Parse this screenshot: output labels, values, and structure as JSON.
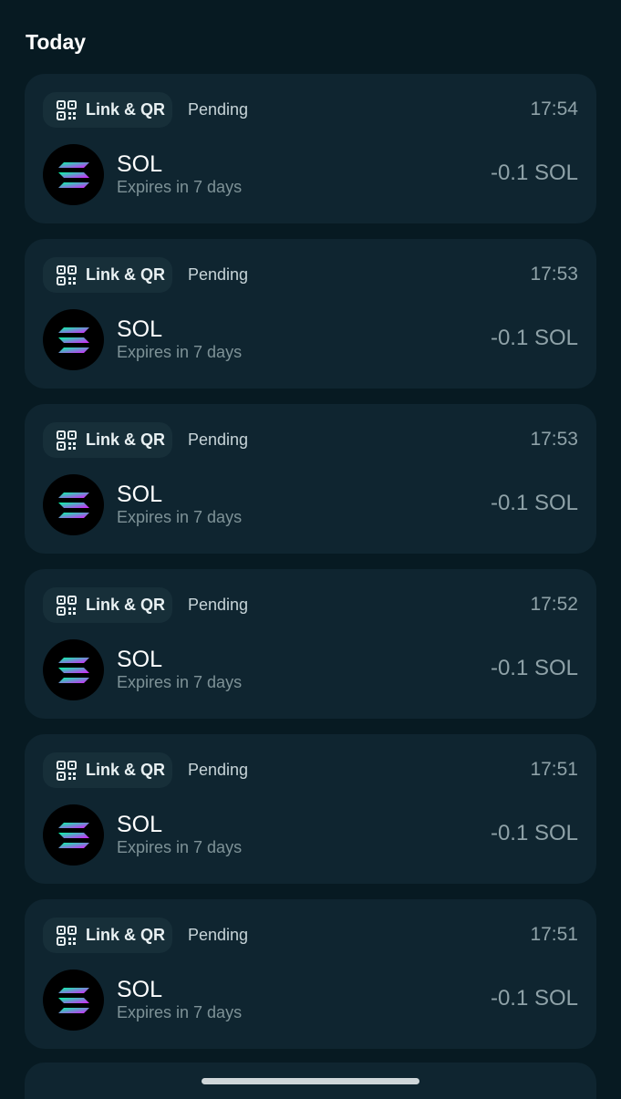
{
  "section": {
    "title": "Today"
  },
  "transactions": [
    {
      "method_icon": "qr-code-icon",
      "method": "Link & QR",
      "status": "Pending",
      "time": "17:54",
      "token_icon": "solana-logo-icon",
      "token": "SOL",
      "expiry": "Expires in 7 days",
      "amount": "-0.1 SOL"
    },
    {
      "method_icon": "qr-code-icon",
      "method": "Link & QR",
      "status": "Pending",
      "time": "17:53",
      "token_icon": "solana-logo-icon",
      "token": "SOL",
      "expiry": "Expires in 7 days",
      "amount": "-0.1 SOL"
    },
    {
      "method_icon": "qr-code-icon",
      "method": "Link & QR",
      "status": "Pending",
      "time": "17:53",
      "token_icon": "solana-logo-icon",
      "token": "SOL",
      "expiry": "Expires in 7 days",
      "amount": "-0.1 SOL"
    },
    {
      "method_icon": "qr-code-icon",
      "method": "Link & QR",
      "status": "Pending",
      "time": "17:52",
      "token_icon": "solana-logo-icon",
      "token": "SOL",
      "expiry": "Expires in 7 days",
      "amount": "-0.1 SOL"
    },
    {
      "method_icon": "qr-code-icon",
      "method": "Link & QR",
      "status": "Pending",
      "time": "17:51",
      "token_icon": "solana-logo-icon",
      "token": "SOL",
      "expiry": "Expires in 7 days",
      "amount": "-0.1 SOL"
    },
    {
      "method_icon": "qr-code-icon",
      "method": "Link & QR",
      "status": "Pending",
      "time": "17:51",
      "token_icon": "solana-logo-icon",
      "token": "SOL",
      "expiry": "Expires in 7 days",
      "amount": "-0.1 SOL"
    }
  ],
  "colors": {
    "background": "#071a22",
    "card": "#0f2530",
    "chip": "#172f39",
    "solana_gradient_start": "#00ffa3",
    "solana_gradient_end": "#dc1fff"
  }
}
